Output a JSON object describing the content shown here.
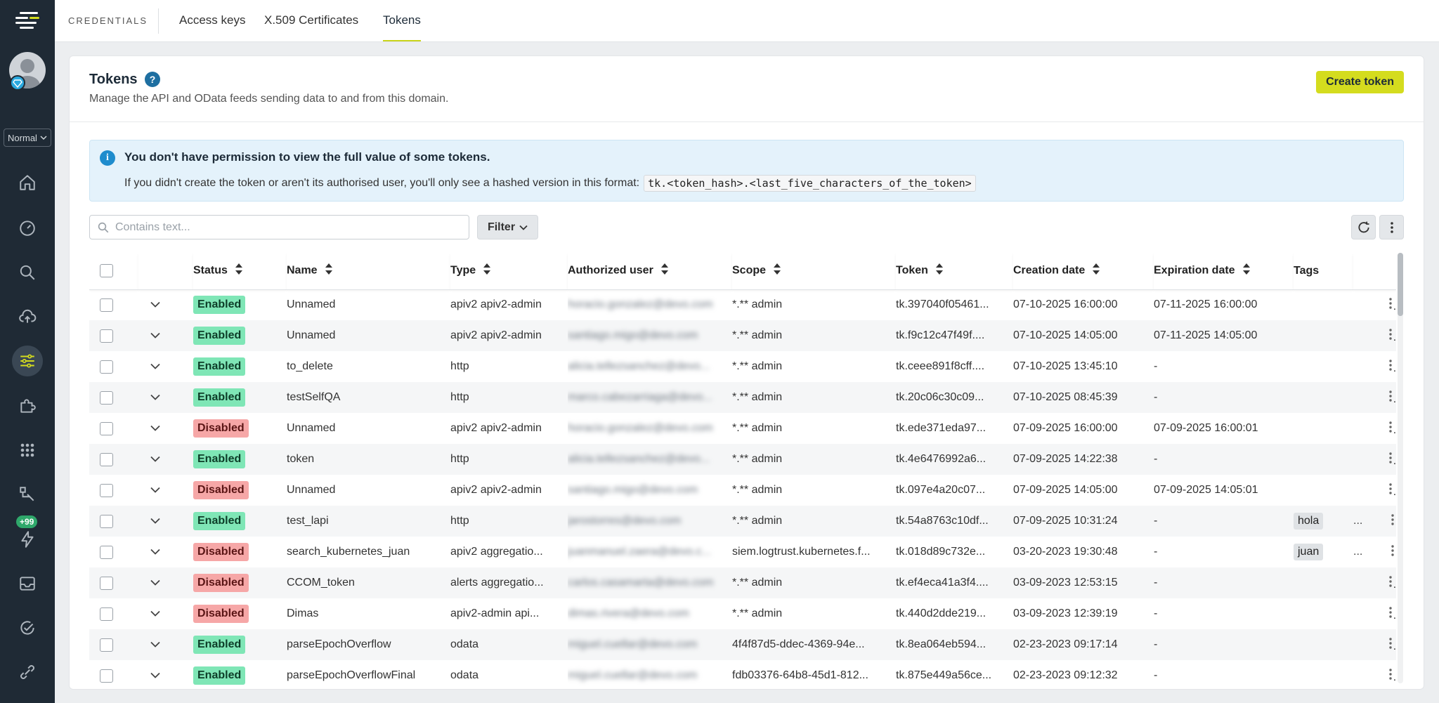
{
  "sidebar": {
    "mode": "Normal",
    "badge": "+99",
    "icons": [
      "home-icon",
      "dashboard-icon",
      "search-icon",
      "upload-icon",
      "sliders-icon",
      "puzzle-icon",
      "apps-icon",
      "flow-icon",
      "bolt-icon",
      "inbox-icon",
      "check-circle-icon",
      "link-icon"
    ]
  },
  "topbar": {
    "section": "CREDENTIALS",
    "tabs": [
      {
        "label": "Access keys"
      },
      {
        "label": "X.509 Certificates"
      },
      {
        "label": "Tokens"
      }
    ]
  },
  "page": {
    "title": "Tokens",
    "subtitle": "Manage the API and OData feeds sending data to and from this domain.",
    "create_label": "Create token"
  },
  "info": {
    "title": "You don't have permission to view the full value of some tokens.",
    "text": "If you didn't create the token or aren't its authorised user, you'll only see a hashed version in this format:",
    "code": "tk.<token_hash>.<last_five_characters_of_the_token>"
  },
  "search": {
    "placeholder": "Contains text..."
  },
  "filter_label": "Filter",
  "table": {
    "columns": [
      "Status",
      "Name",
      "Type",
      "Authorized user",
      "Scope",
      "Token",
      "Creation date",
      "Expiration date",
      "Tags"
    ],
    "rows": [
      {
        "status": "Enabled",
        "name": "Unnamed",
        "type": "apiv2 apiv2-admin",
        "user": "horacio.gonzalez@devo.com",
        "scope": "*.** admin",
        "token": "tk.397040f05461...",
        "created": "07-10-2025 16:00:00",
        "expires": "07-11-2025 16:00:00",
        "tag": ""
      },
      {
        "status": "Enabled",
        "name": "Unnamed",
        "type": "apiv2 apiv2-admin",
        "user": "santiago.migo@devo.com",
        "scope": "*.** admin",
        "token": "tk.f9c12c47f49f....",
        "created": "07-10-2025 14:05:00",
        "expires": "07-11-2025 14:05:00",
        "tag": ""
      },
      {
        "status": "Enabled",
        "name": "to_delete",
        "type": "http",
        "user": "alicia.tellezsanchez@devo...",
        "scope": "*.** admin",
        "token": "tk.ceee891f8cff....",
        "created": "07-10-2025 13:45:10",
        "expires": "-",
        "tag": ""
      },
      {
        "status": "Enabled",
        "name": "testSelfQA",
        "type": "http",
        "user": "marco.cabezarriaga@devo...",
        "scope": "*.** admin",
        "token": "tk.20c06c30c09...",
        "created": "07-10-2025 08:45:39",
        "expires": "-",
        "tag": ""
      },
      {
        "status": "Disabled",
        "name": "Unnamed",
        "type": "apiv2 apiv2-admin",
        "user": "horacio.gonzalez@devo.com",
        "scope": "*.** admin",
        "token": "tk.ede371eda97...",
        "created": "07-09-2025 16:00:00",
        "expires": "07-09-2025 16:00:01",
        "tag": ""
      },
      {
        "status": "Enabled",
        "name": "token",
        "type": "http",
        "user": "alicia.tellezsanchez@devo...",
        "scope": "*.** admin",
        "token": "tk.4e6476992a6...",
        "created": "07-09-2025 14:22:38",
        "expires": "-",
        "tag": ""
      },
      {
        "status": "Disabled",
        "name": "Unnamed",
        "type": "apiv2 apiv2-admin",
        "user": "santiago.migo@devo.com",
        "scope": "*.** admin",
        "token": "tk.097e4a20c07...",
        "created": "07-09-2025 14:05:00",
        "expires": "07-09-2025 14:05:01",
        "tag": ""
      },
      {
        "status": "Enabled",
        "name": "test_lapi",
        "type": "http",
        "user": "jarostorres@devo.com",
        "scope": "*.** admin",
        "token": "tk.54a8763c10df...",
        "created": "07-09-2025 10:31:24",
        "expires": "-",
        "tag": "hola"
      },
      {
        "status": "Disabled",
        "name": "search_kubernetes_juan",
        "type": "apiv2 aggregatio...",
        "user": "juanmanuel.zaera@devo.c...",
        "scope": "siem.logtrust.kubernetes.f...",
        "token": "tk.018d89c732e...",
        "created": "03-20-2023 19:30:48",
        "expires": "-",
        "tag": "juan"
      },
      {
        "status": "Disabled",
        "name": "CCOM_token",
        "type": "alerts aggregatio...",
        "user": "carlos.casamarta@devo.com",
        "scope": "*.** admin",
        "token": "tk.ef4eca41a3f4....",
        "created": "03-09-2023 12:53:15",
        "expires": "-",
        "tag": ""
      },
      {
        "status": "Disabled",
        "name": "Dimas",
        "type": "apiv2-admin api...",
        "user": "dimas.rivera@devo.com",
        "scope": "*.** admin",
        "token": "tk.440d2dde219...",
        "created": "03-09-2023 12:39:19",
        "expires": "-",
        "tag": ""
      },
      {
        "status": "Enabled",
        "name": "parseEpochOverflow",
        "type": "odata",
        "user": "miguel.cuellar@devo.com",
        "scope": "4f4f87d5-ddec-4369-94e...",
        "token": "tk.8ea064eb594...",
        "created": "02-23-2023 09:17:14",
        "expires": "-",
        "tag": ""
      },
      {
        "status": "Enabled",
        "name": "parseEpochOverflowFinal",
        "type": "odata",
        "user": "miguel.cuellar@devo.com",
        "scope": "fdb03376-64b8-45d1-812...",
        "token": "tk.875e449a56ce...",
        "created": "02-23-2023 09:12:32",
        "expires": "-",
        "tag": ""
      }
    ]
  }
}
